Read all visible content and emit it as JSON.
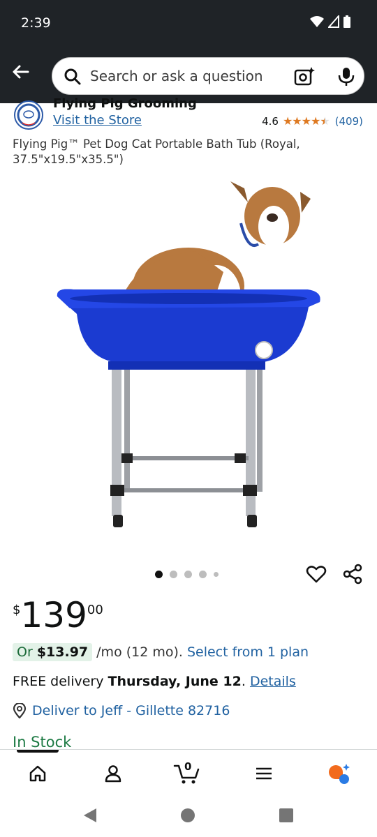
{
  "status_bar": {
    "time": "2:39"
  },
  "search": {
    "placeholder": "Search or ask a question"
  },
  "brand": {
    "name": "Flying Pig Grooming",
    "visit_store": "Visit the Store"
  },
  "rating": {
    "value": "4.6",
    "stars_filled": 4.5,
    "count": "(409)",
    "color": "#de7921"
  },
  "product": {
    "title": "Flying Pig™ Pet Dog Cat Portable Bath Tub (Royal, 37.5\"x19.5\"x35.5\")",
    "image_alt": "Blue portable pet bath tub on metal legs with a dog sitting in it"
  },
  "carousel": {
    "total": 5,
    "active": 1
  },
  "price": {
    "symbol": "$",
    "whole": "139",
    "fraction": "00"
  },
  "installment": {
    "prefix": "Or",
    "amount": "$13.97",
    "term": "/mo (12 mo).",
    "link": "Select from 1 plan"
  },
  "delivery": {
    "prefix": "FREE delivery",
    "date": "Thursday, June 12",
    "suffix": ".",
    "link": "Details"
  },
  "deliver_to": {
    "text": "Deliver to Jeff - Gillette 82716"
  },
  "stock": {
    "text": "In Stock"
  },
  "bottom_nav": {
    "items": [
      {
        "name": "home-icon"
      },
      {
        "name": "account-icon"
      },
      {
        "name": "cart-icon"
      },
      {
        "name": "menu-icon"
      },
      {
        "name": "rufus-icon"
      }
    ],
    "cart_count": "0"
  },
  "colors": {
    "header": "#1f2327",
    "link": "#2162a1",
    "stock": "#1d7a44",
    "tub": "#1b3bd1"
  }
}
